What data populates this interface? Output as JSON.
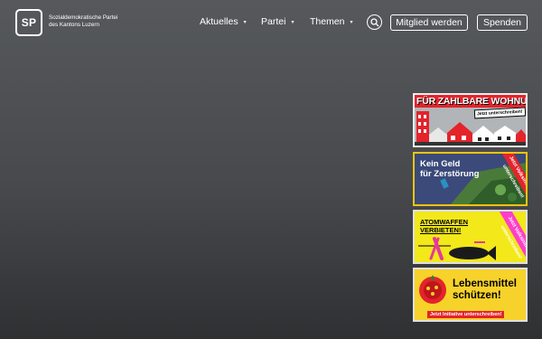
{
  "logo": {
    "mark": "SP",
    "line1": "Sozialdemokratische Partei",
    "line2": "des Kantons Luzern"
  },
  "nav": {
    "items": [
      {
        "label": "Aktuelles"
      },
      {
        "label": "Partei"
      },
      {
        "label": "Themen"
      }
    ],
    "caret": "▾"
  },
  "search": {
    "icon": "search-icon"
  },
  "buttons": {
    "member": "Mitglied werden",
    "donate": "Spenden"
  },
  "banners": [
    {
      "headline": "FÜR ZAHLBARE WOHNUNGEN",
      "cta": "Jetzt unterschreiben!"
    },
    {
      "line1": "Kein Geld",
      "line2": "für Zerstörung",
      "ribbon": "Jetzt Volksinitiative unterschreiben!"
    },
    {
      "line1": "ATOMWAFFEN",
      "line2": "VERBIETEN!",
      "ribbon": "Jetzt Volksinitiative unterschreiben!"
    },
    {
      "line1": "Lebensmittel",
      "line2": "schützen!",
      "cta": "Jetzt Initiative unterschreiben!"
    }
  ],
  "colors": {
    "accent_red": "#e3242b",
    "pink": "#ff3ec8",
    "yellow": "#f2e81a"
  }
}
